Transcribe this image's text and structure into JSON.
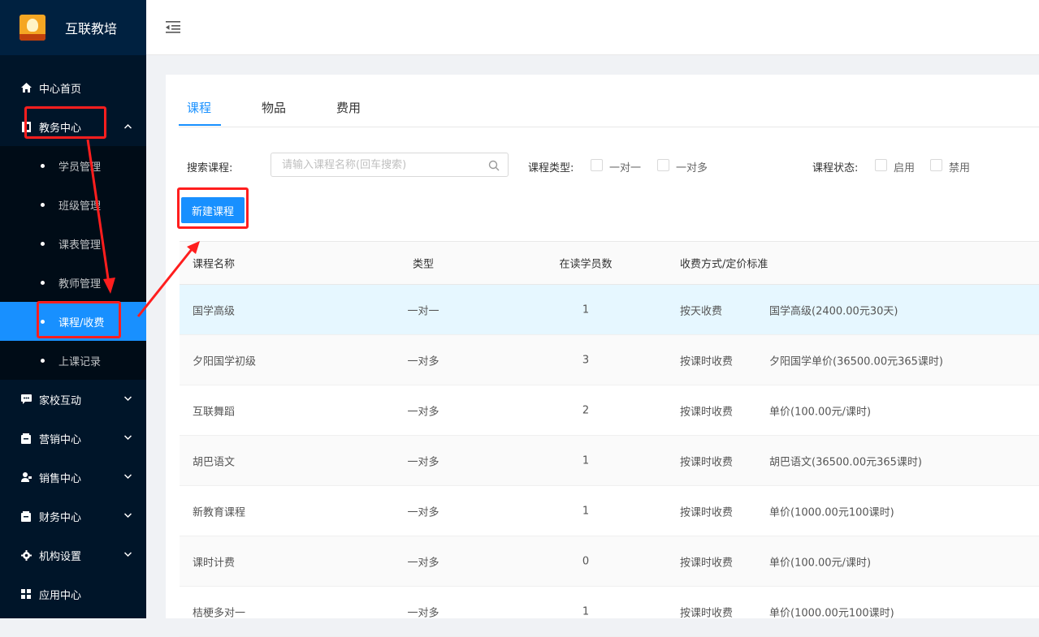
{
  "app": {
    "title": "互联教培",
    "logo_text": "互联教培"
  },
  "sidebar": {
    "items": [
      {
        "label": "中心首页",
        "icon": "home-icon"
      },
      {
        "label": "教务中心",
        "icon": "academic-icon",
        "expanded": true,
        "children": [
          {
            "label": "学员管理"
          },
          {
            "label": "班级管理"
          },
          {
            "label": "课表管理"
          },
          {
            "label": "教师管理"
          },
          {
            "label": "课程/收费",
            "active": true
          },
          {
            "label": "上课记录"
          }
        ]
      },
      {
        "label": "家校互动",
        "icon": "chat-icon"
      },
      {
        "label": "营销中心",
        "icon": "marketing-icon"
      },
      {
        "label": "销售中心",
        "icon": "sales-icon"
      },
      {
        "label": "财务中心",
        "icon": "finance-icon"
      },
      {
        "label": "机构设置",
        "icon": "gear-icon"
      },
      {
        "label": "应用中心",
        "icon": "apps-icon"
      }
    ]
  },
  "tabs": [
    {
      "label": "课程",
      "active": true
    },
    {
      "label": "物品"
    },
    {
      "label": "费用"
    }
  ],
  "filters": {
    "search_label": "搜索课程:",
    "search_placeholder": "请输入课程名称(回车搜索)",
    "type_label": "课程类型:",
    "type_options": [
      "一对一",
      "一对多"
    ],
    "status_label": "课程状态:",
    "status_options": [
      "启用",
      "禁用"
    ]
  },
  "new_button": "新建课程",
  "table": {
    "headers": [
      "课程名称",
      "类型",
      "在读学员数",
      "收费方式/定价标准"
    ],
    "rows": [
      {
        "name": "国学高级",
        "type": "一对一",
        "students": "1",
        "charge": "按天收费",
        "price": "国学高级(2400.00元30天)"
      },
      {
        "name": "夕阳国学初级",
        "type": "一对多",
        "students": "3",
        "charge": "按课时收费",
        "price": "夕阳国学单价(36500.00元365课时)"
      },
      {
        "name": "互联舞蹈",
        "type": "一对多",
        "students": "2",
        "charge": "按课时收费",
        "price": "单价(100.00元/课时)"
      },
      {
        "name": "胡巴语文",
        "type": "一对多",
        "students": "1",
        "charge": "按课时收费",
        "price": "胡巴语文(36500.00元365课时)"
      },
      {
        "name": "新教育课程",
        "type": "一对多",
        "students": "1",
        "charge": "按课时收费",
        "price": "单价(1000.00元100课时)"
      },
      {
        "name": "课时计费",
        "type": "一对多",
        "students": "0",
        "charge": "按课时收费",
        "price": "单价(100.00元/课时)"
      },
      {
        "name": "桔梗多对一",
        "type": "一对多",
        "students": "1",
        "charge": "按课时收费",
        "price": "单价(1000.00元100课时)"
      }
    ]
  },
  "colors": {
    "sidebar": "#001529",
    "accent": "#1890ff",
    "annotation": "#ff1e1e"
  }
}
